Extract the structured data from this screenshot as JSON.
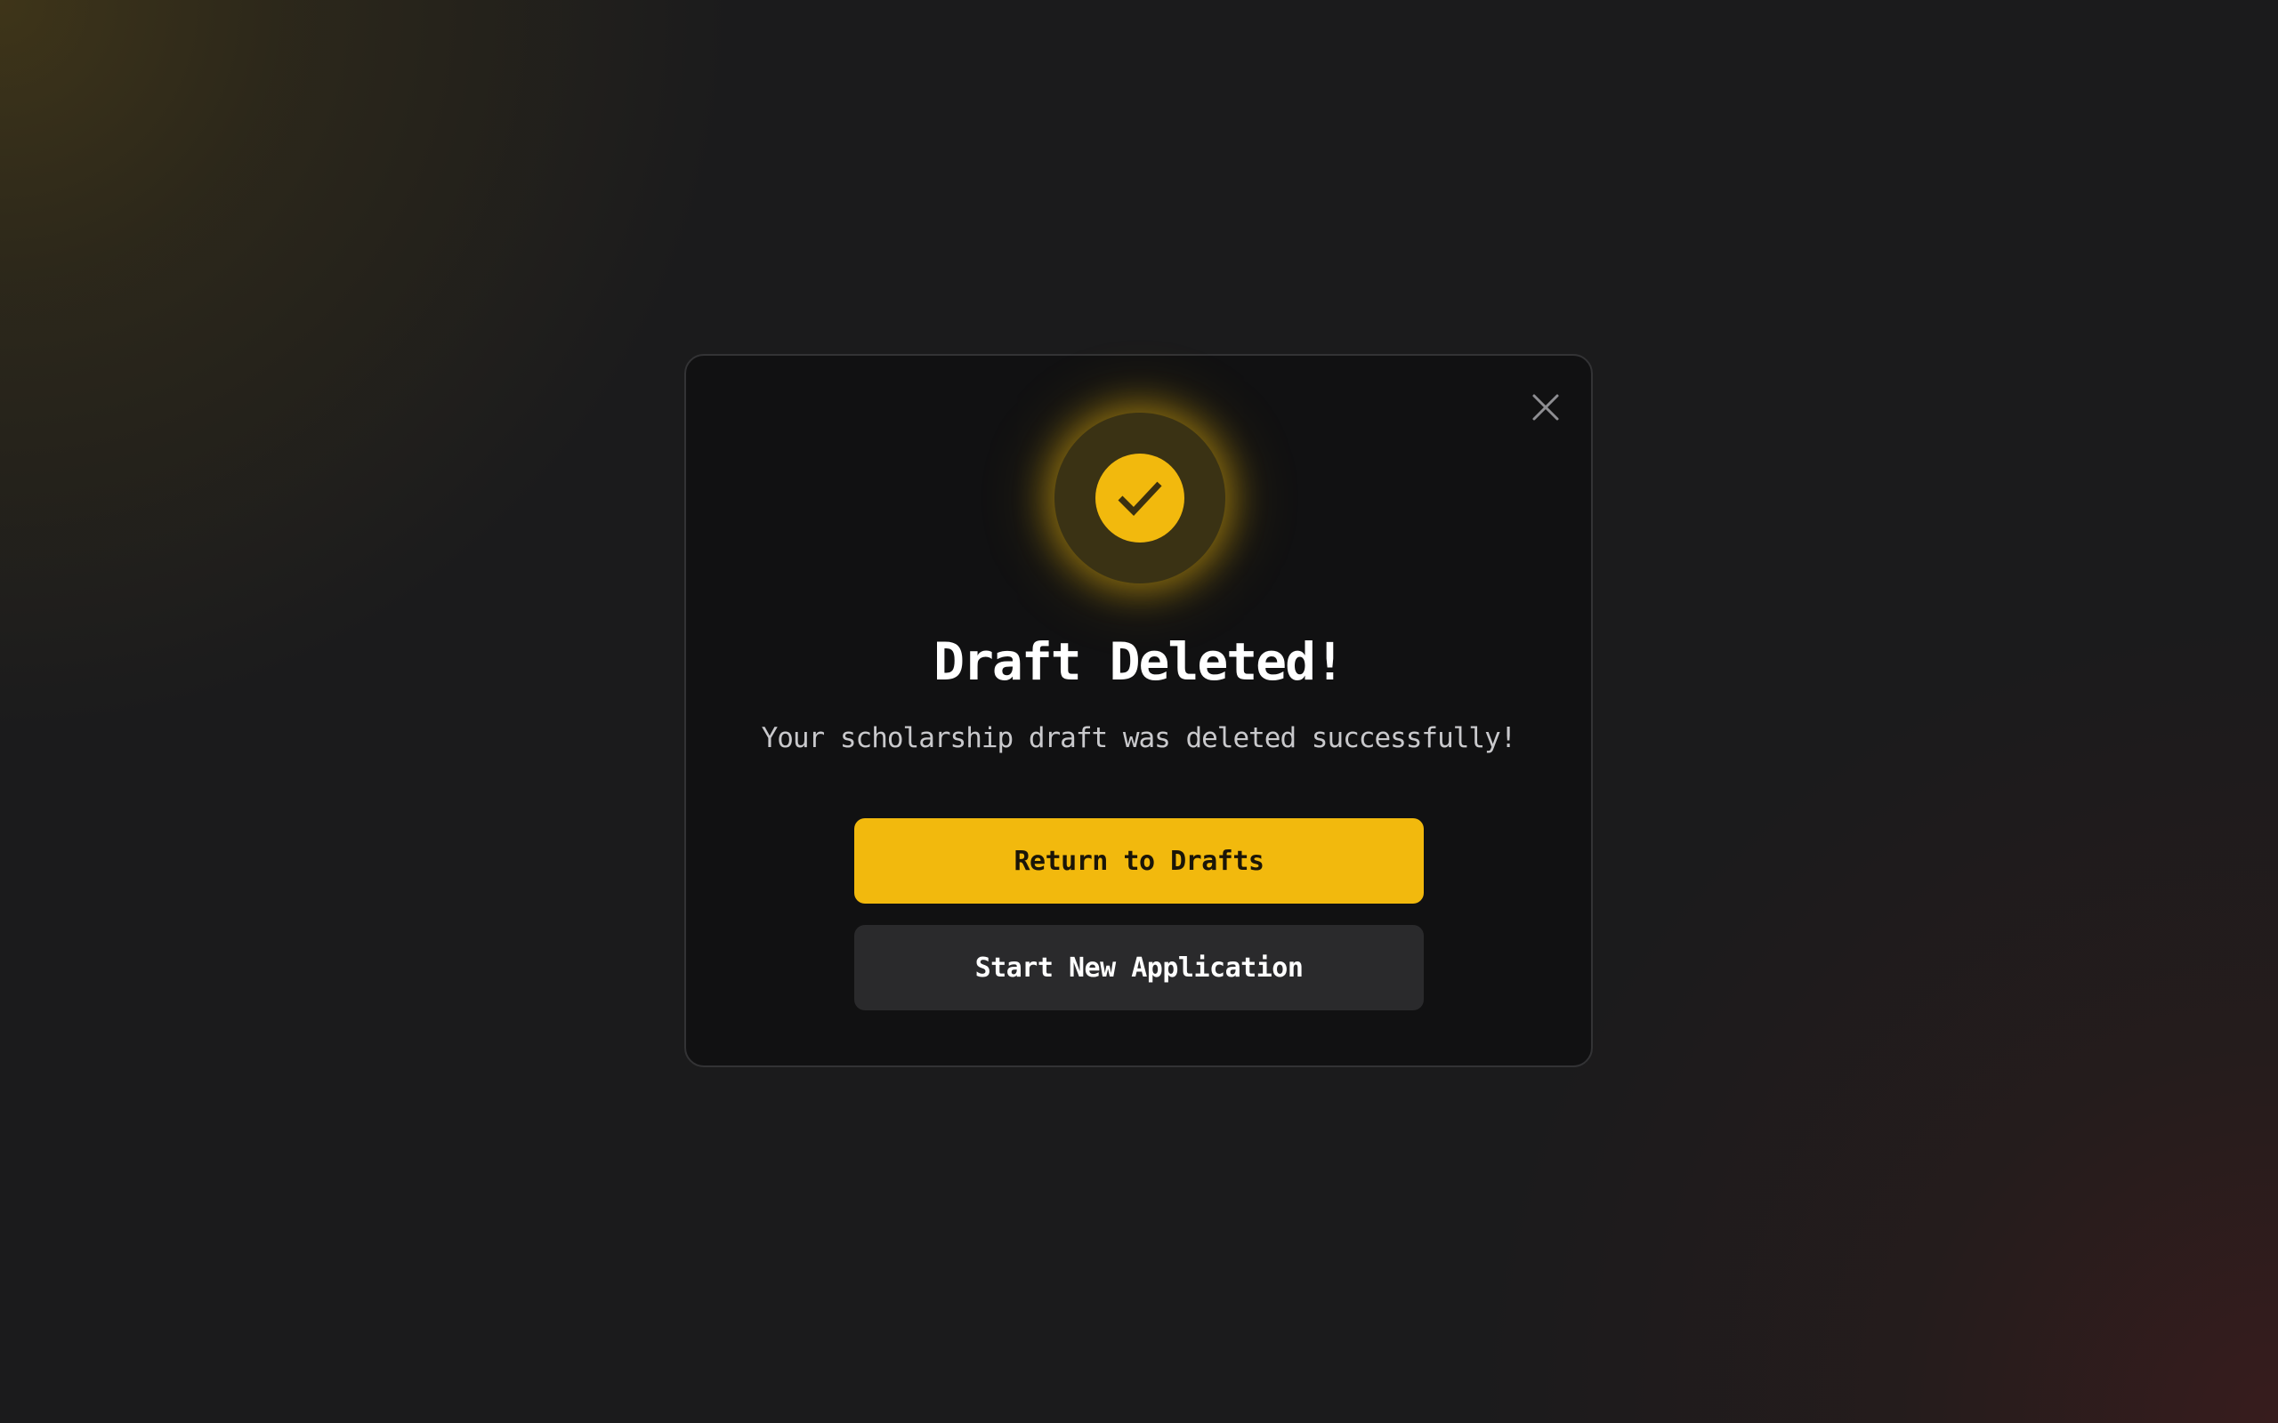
{
  "dialog": {
    "title": "Draft Deleted!",
    "message": "Your scholarship draft was deleted successfully!",
    "close_icon": "close-icon",
    "status_icon": "check-circle-icon",
    "primary_button_label": "Return to Drafts",
    "secondary_button_label": "Start New Application"
  },
  "colors": {
    "accent": "#f2b90d",
    "background": "#1b1b1c",
    "dialog_background": "#111112",
    "secondary_button": "#2a2a2c"
  }
}
